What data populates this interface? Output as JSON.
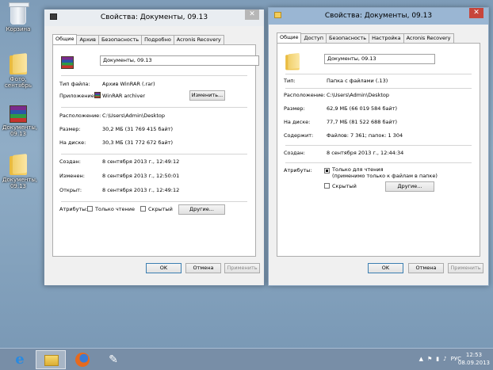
{
  "desktop": {
    "icons": [
      {
        "label": "Корзина",
        "icon": "recycle-bin-icon"
      },
      {
        "label": "Фото, сентябрь",
        "icon": "folder-icon"
      },
      {
        "label": "Документы, 09.13",
        "icon": "winrar-archive-icon"
      },
      {
        "label": "Документы, 09.13",
        "icon": "folder-icon"
      }
    ]
  },
  "window1": {
    "title": "Свойства: Документы, 09.13",
    "close": "✕",
    "tabs": [
      "Общие",
      "Архив",
      "Безопасность",
      "Подробно",
      "Acronis Recovery"
    ],
    "name_value": "Документы, 09.13",
    "file_type_label": "Тип файла:",
    "file_type_value": "Архив WinRAR (.rar)",
    "app_label": "Приложение:",
    "app_value": "WinRAR archiver",
    "change_button": "Изменить...",
    "location_label": "Расположение:",
    "location_value": "C:\\Users\\Admin\\Desktop",
    "size_label": "Размер:",
    "size_value": "30,2 МБ (31 769 415 байт)",
    "disk_label": "На диске:",
    "disk_value": "30,3 МБ (31 772 672 байт)",
    "created_label": "Создан:",
    "created_value": "8 сентября 2013 г., 12:49:12",
    "modified_label": "Изменен:",
    "modified_value": "8 сентября 2013 г., 12:50:01",
    "opened_label": "Открыт:",
    "opened_value": "8 сентября 2013 г., 12:49:12",
    "attributes_label": "Атрибуты:",
    "readonly_label": "Только чтение",
    "hidden_label": "Скрытый",
    "other_button": "Другие...",
    "ok": "OK",
    "cancel": "Отмена",
    "apply": "Применить"
  },
  "window2": {
    "title": "Свойства: Документы, 09.13",
    "close": "✕",
    "tabs": [
      "Общие",
      "Доступ",
      "Безопасность",
      "Настройка",
      "Acronis Recovery"
    ],
    "name_value": "Документы, 09.13",
    "type_label": "Тип:",
    "type_value": "Папка с файлами (.13)",
    "location_label": "Расположение:",
    "location_value": "C:\\Users\\Admin\\Desktop",
    "size_label": "Размер:",
    "size_value": "62,9 МБ (66 019 584 байт)",
    "disk_label": "На диске:",
    "disk_value": "77,7 МБ (81 522 688 байт)",
    "contains_label": "Содержит:",
    "contains_value": "Файлов: 7 361; папок: 1 304",
    "created_label": "Создан:",
    "created_value": "8 сентября 2013 г., 12:44:34",
    "attributes_label": "Атрибуты:",
    "readonly_label": "Только для чтения",
    "readonly_sub": "(применимо только к файлам в папке)",
    "hidden_label": "Скрытый",
    "other_button": "Другие...",
    "ok": "OK",
    "cancel": "Отмена",
    "apply": "Применить"
  },
  "taskbar": {
    "language": "РУС",
    "time": "12:53",
    "date": "08.09.2013",
    "tray_up": "▲"
  }
}
